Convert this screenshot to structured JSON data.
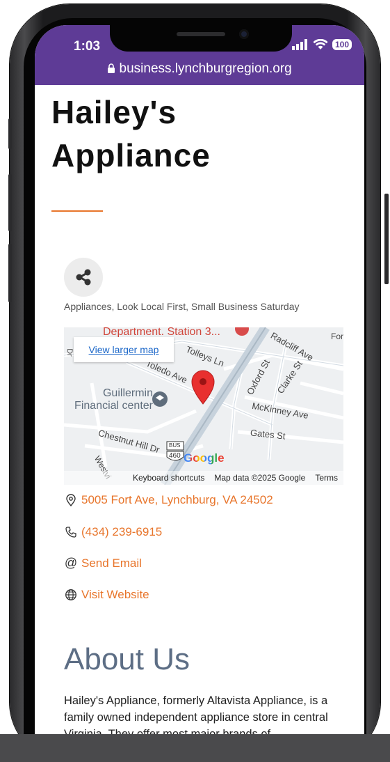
{
  "status_bar": {
    "time": "1:03",
    "signal_icon": "signal-bars-icon",
    "wifi_icon": "wifi-icon",
    "battery_level": "100",
    "url": "business.lynchburgregion.org",
    "lock_icon": "lock-icon",
    "bar_color": "#5e3b96"
  },
  "business": {
    "name_line1": "Hailey's",
    "name_line2": "Appliance",
    "accent_color": "#e8752b",
    "categories": "Appliances, Look Local First, Small Business Saturday",
    "share_icon": "share-icon"
  },
  "map": {
    "view_larger_label": "View larger map",
    "labels": {
      "department": "Department. Station 3...",
      "tolleys": "Tolleys Ln",
      "toledo": "Toledo Ave",
      "radcliff": "Radcliff Ave",
      "oxford": "Oxford St",
      "clarke": "Clarke St",
      "guillermin1": "Guillermin",
      "guillermin2": "Financial center",
      "mckinney": "McKinney Ave",
      "gates": "Gates St",
      "chestnut": "Chestnut Hill Dr",
      "bus": "BUS",
      "route": "460",
      "westvi": "Westvi",
      "for": "For",
      "dr": "Dr"
    },
    "google_logo": "Google",
    "keyboard_shortcuts": "Keyboard shortcuts",
    "map_data": "Map data ©2025 Google",
    "terms": "Terms"
  },
  "contact": {
    "address": "5005 Fort Ave, Lynchburg, VA 24502",
    "phone": "(434) 239-6915",
    "email": "Send Email",
    "website": "Visit Website"
  },
  "about": {
    "title": "About Us",
    "text": "Hailey's Appliance, formerly Altavista Appliance, is a family owned independent appliance store in central Virginia. They offer most major brands of"
  }
}
